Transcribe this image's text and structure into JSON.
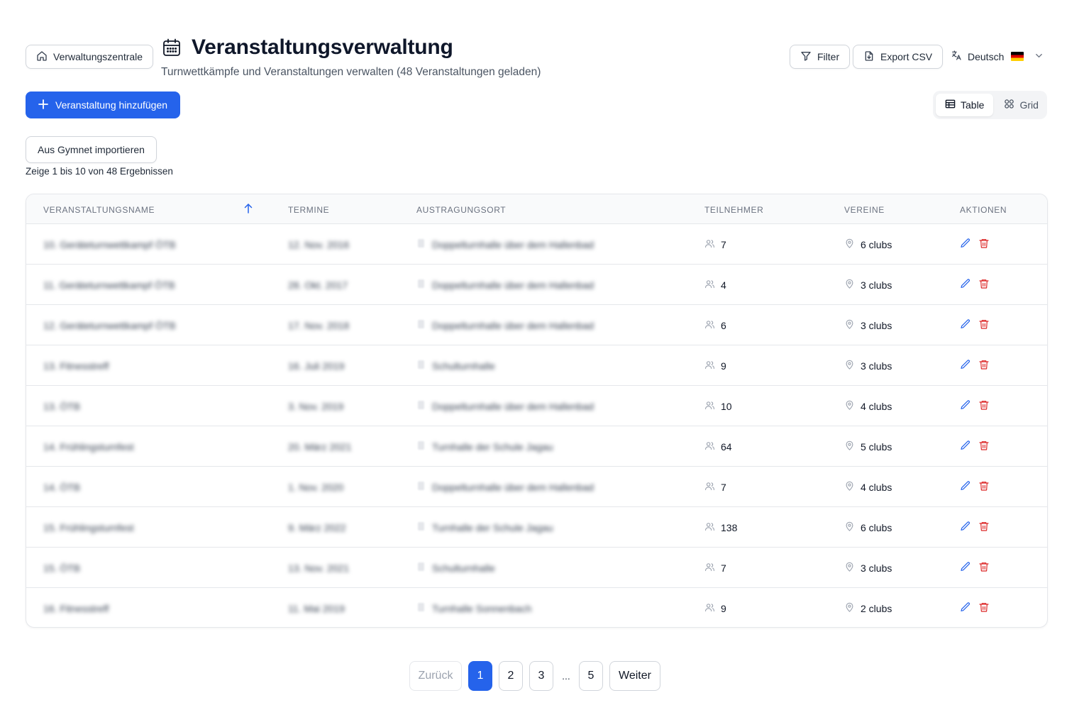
{
  "header": {
    "home_button": "Verwaltungszentrale",
    "title": "Veranstaltungsverwaltung",
    "subtitle": "Turnwettkämpfe und Veranstaltungen verwalten (48 Veranstaltungen geladen)",
    "filter_button": "Filter",
    "export_button": "Export CSV",
    "language": "Deutsch"
  },
  "toolbar": {
    "add_button": "Veranstaltung hinzufügen",
    "import_button": "Aus Gymnet importieren",
    "view_toggle": {
      "table": "Table",
      "grid": "Grid",
      "active": "table"
    },
    "results_info": "Zeige 1 bis 10 von 48 Ergebnissen"
  },
  "table": {
    "columns": {
      "name": "Veranstaltungsname",
      "dates": "Termine",
      "venue": "Austragungsort",
      "participants": "Teilnehmer",
      "clubs": "Vereine",
      "actions": "Aktionen"
    },
    "rows": [
      {
        "name": "10. Geräteturnwettkampf ÖTB",
        "date": "12. Nov. 2016",
        "venue": "Doppelturnhalle über dem Hallenbad",
        "participants": "7",
        "clubs": "6 clubs"
      },
      {
        "name": "11. Geräteturnwettkampf ÖTB",
        "date": "28. Okt. 2017",
        "venue": "Doppelturnhalle über dem Hallenbad",
        "participants": "4",
        "clubs": "3 clubs"
      },
      {
        "name": "12. Geräteturnwettkampf ÖTB",
        "date": "17. Nov. 2018",
        "venue": "Doppelturnhalle über dem Hallenbad",
        "participants": "6",
        "clubs": "3 clubs"
      },
      {
        "name": "13. Fitnesstreff",
        "date": "16. Juli 2019",
        "venue": "Schulturnhalle",
        "participants": "9",
        "clubs": "3 clubs"
      },
      {
        "name": "13. ÖTB",
        "date": "3. Nov. 2019",
        "venue": "Doppelturnhalle über dem Hallenbad",
        "participants": "10",
        "clubs": "4 clubs"
      },
      {
        "name": "14. Frühlingsturnfest",
        "date": "20. März 2021",
        "venue": "Turnhalle der Schule Jagau",
        "participants": "64",
        "clubs": "5 clubs"
      },
      {
        "name": "14. ÖTB",
        "date": "1. Nov. 2020",
        "venue": "Doppelturnhalle über dem Hallenbad",
        "participants": "7",
        "clubs": "4 clubs"
      },
      {
        "name": "15. Frühlingsturnfest",
        "date": "9. März 2022",
        "venue": "Turnhalle der Schule Jagau",
        "participants": "138",
        "clubs": "6 clubs"
      },
      {
        "name": "15. ÖTB",
        "date": "13. Nov. 2021",
        "venue": "Schulturnhalle",
        "participants": "7",
        "clubs": "3 clubs"
      },
      {
        "name": "16. Fitnesstreff",
        "date": "11. Mai 2019",
        "venue": "Turnhalle Sonnenbach",
        "participants": "9",
        "clubs": "2 clubs"
      }
    ]
  },
  "pagination": {
    "prev": "Zurück",
    "next": "Weiter",
    "pages": [
      "1",
      "2",
      "3"
    ],
    "ellipsis": "...",
    "last": "5",
    "current": "1"
  },
  "colors": {
    "primary": "#2563eb",
    "danger": "#dc2626",
    "border": "#e5e7eb"
  }
}
